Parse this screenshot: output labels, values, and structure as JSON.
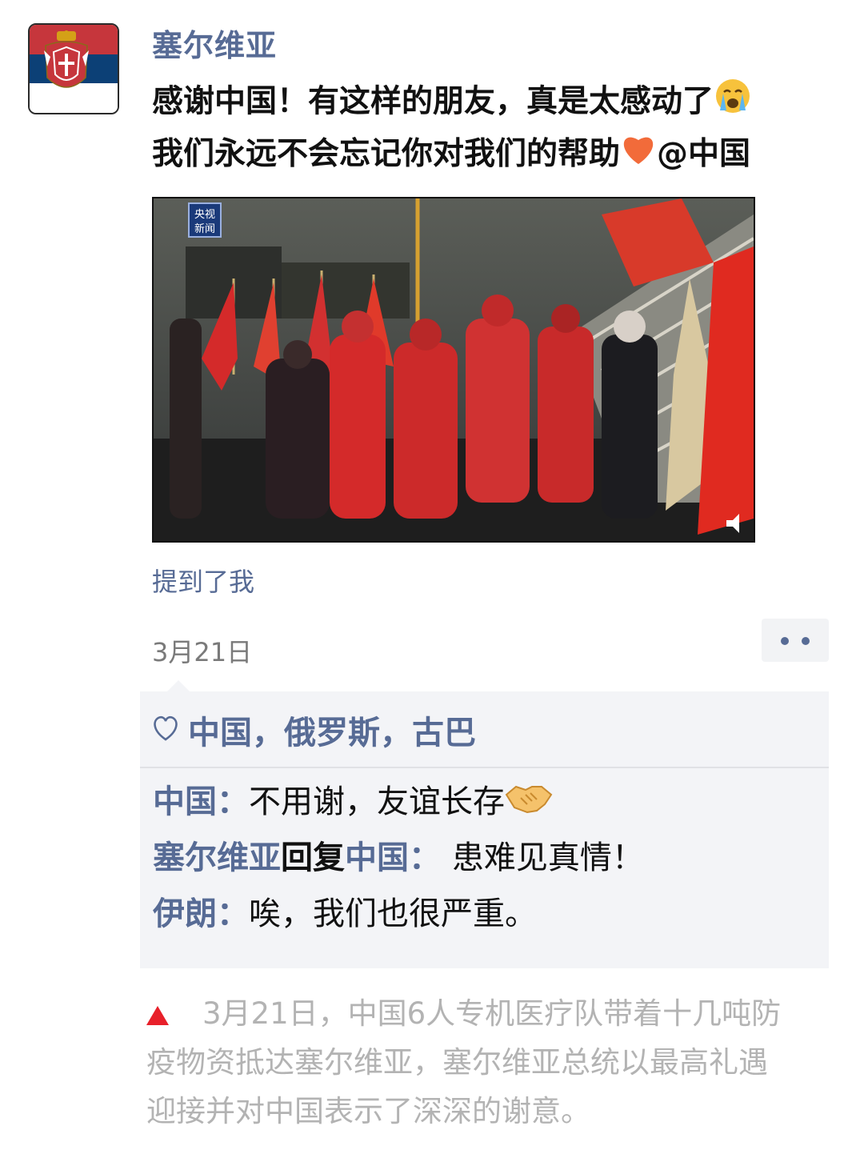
{
  "post": {
    "author": "塞尔维亚",
    "avatar_icon": "serbia-flag-icon",
    "text_line1": "感谢中国！有这样的朋友，真是太感动了",
    "text_line2": "我们永远不会忘记你对我们的帮助",
    "text_line2_tail": "@中国",
    "emoji_cry": "loudly-crying-face-icon",
    "emoji_heart": "orange-heart-icon",
    "video_thumbnail": "airport-welcome-video-thumbnail",
    "video_watermark": "央视新闻",
    "mention": "提到了我",
    "date": "3月21日"
  },
  "likes": {
    "icon": "heart-outline-icon",
    "names": "中国，俄罗斯，古巴"
  },
  "comments": [
    {
      "author": "中国",
      "sep": "：",
      "text": "不用谢，友谊长存",
      "emoji": "handshake-icon"
    },
    {
      "author": "塞尔维亚",
      "reply_word": "回复",
      "reply_to": "中国",
      "sep": "： ",
      "text": "患难见真情！"
    },
    {
      "author": "伊朗",
      "sep": "：",
      "text": "唉，我们也很严重。"
    }
  ],
  "caption": {
    "line1": "3月21日，中国6人专机医疗队带着十几吨防",
    "line2": "疫物资抵达塞尔维亚，塞尔维亚总统以最高礼遇",
    "line3": "迎接并对中国表示了深深的谢意。"
  },
  "colors": {
    "link_blue": "#576b95",
    "comment_bg": "#f3f4f7",
    "caption_gray": "#b3b3b3",
    "triangle_red": "#e8202a",
    "serbia_red": "#c6363c",
    "serbia_blue": "#0c4076"
  }
}
